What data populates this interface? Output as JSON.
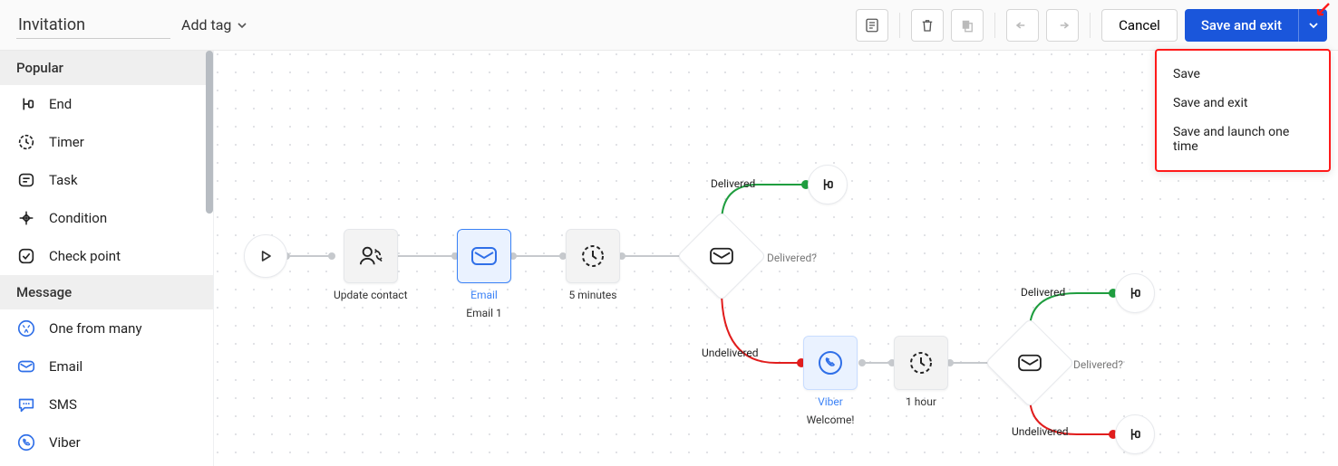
{
  "header": {
    "flow_name": "Invitation",
    "add_tag_label": "Add tag",
    "cancel_label": "Cancel",
    "save_exit_label": "Save and exit"
  },
  "save_menu": {
    "items": [
      "Save",
      "Save and exit",
      "Save and launch one time"
    ]
  },
  "sidebar": {
    "sections": [
      {
        "title": "Popular",
        "items": [
          "End",
          "Timer",
          "Task",
          "Condition",
          "Check point"
        ]
      },
      {
        "title": "Message",
        "items": [
          "One from many",
          "Email",
          "SMS",
          "Viber"
        ]
      }
    ]
  },
  "canvas": {
    "nodes": {
      "update_contact": {
        "label": "Update contact"
      },
      "email": {
        "type": "Email",
        "label": "Email 1"
      },
      "timer1": {
        "label": "5 minutes"
      },
      "cond1": {
        "label": "Delivered?"
      },
      "cond1_yes": "Delivered",
      "cond1_no": "Undelivered",
      "viber": {
        "type": "Viber",
        "label": "Welcome!"
      },
      "timer2": {
        "label": "1 hour"
      },
      "cond2": {
        "label": "Delivered?"
      },
      "cond2_yes": "Delivered",
      "cond2_no": "Undelivered"
    }
  },
  "colors": {
    "accent": "#1a56db",
    "green": "#1f9d3f",
    "red": "#e11d1d"
  }
}
